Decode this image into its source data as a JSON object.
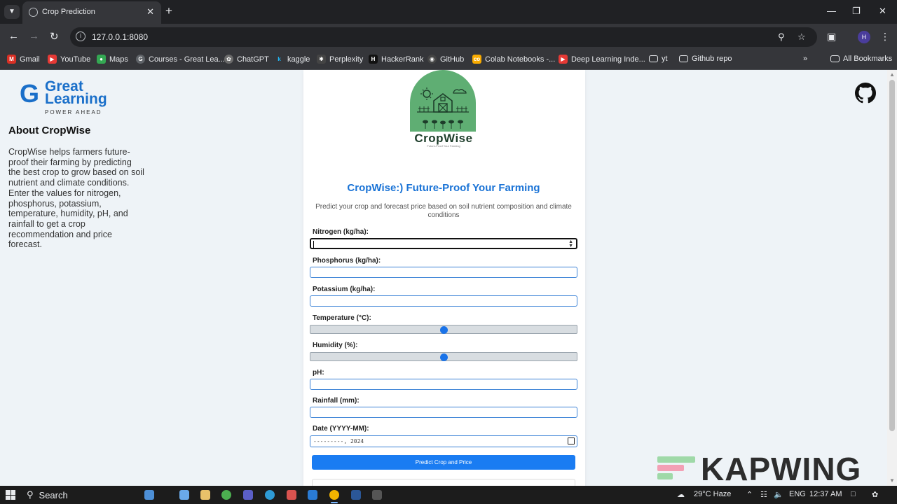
{
  "browser": {
    "tab_title": "Crop Prediction",
    "url": "127.0.0.1:8080",
    "bookmarks": [
      {
        "label": "Gmail",
        "color": "#d93025"
      },
      {
        "label": "YouTube",
        "color": "#e53935"
      },
      {
        "label": "Maps",
        "color": "#34a853"
      },
      {
        "label": "Courses - Great Lea...",
        "color": "#5f6368"
      },
      {
        "label": "ChatGPT",
        "color": "#6b6b6b"
      },
      {
        "label": "kaggle",
        "color": "#20beff"
      },
      {
        "label": "Perplexity",
        "color": "#444444"
      },
      {
        "label": "HackerRank",
        "color": "#111111"
      },
      {
        "label": "GitHub",
        "color": "#444444"
      },
      {
        "label": "Colab Notebooks -...",
        "color": "#f9ab00"
      },
      {
        "label": "Deep Learning Inde...",
        "color": "#e53935"
      },
      {
        "label": "yt",
        "color": "folder"
      },
      {
        "label": "Github repo",
        "color": "folder"
      }
    ],
    "all_bookmarks": "All Bookmarks"
  },
  "sidebar": {
    "logo_line1": "Great",
    "logo_line2": "Learning",
    "logo_tagline": "POWER AHEAD",
    "about_title": "About CropWise",
    "about_text": "CropWise helps farmers future-proof their farming by predicting the best crop to grow based on soil nutrient and climate conditions. Enter the values for nitrogen, phosphorus, potassium, temperature, humidity, pH, and rainfall to get a crop recommendation and price forecast."
  },
  "card": {
    "logo_name": "CropWise",
    "logo_sub": "Future-Proof Your Farming",
    "title": "CropWise:) Future-Proof Your Farming",
    "subtitle": "Predict your crop and forecast price based on soil nutrient composition and climate conditions",
    "fields": {
      "nitrogen": "Nitrogen (kg/ha):",
      "phosphorus": "Phosphorus (kg/ha):",
      "potassium": "Potassium (kg/ha):",
      "temperature": "Temperature (°C):",
      "humidity": "Humidity (%):",
      "ph": "pH:",
      "rainfall": "Rainfall (mm):",
      "date": "Date (YYYY-MM):"
    },
    "temperature_level": 0.5,
    "humidity_level": 0.5,
    "date_value": "---------, 2024",
    "predict_button": "Predict Crop and Price"
  },
  "watermark": "KAPWING",
  "taskbar": {
    "search": "Search",
    "weather": "29°C Haze",
    "language": "ENG",
    "time": "12:37 AM"
  },
  "colors": {
    "accent": "#1a73d6",
    "button": "#1a7cf2",
    "brand_green": "#5fae73"
  }
}
